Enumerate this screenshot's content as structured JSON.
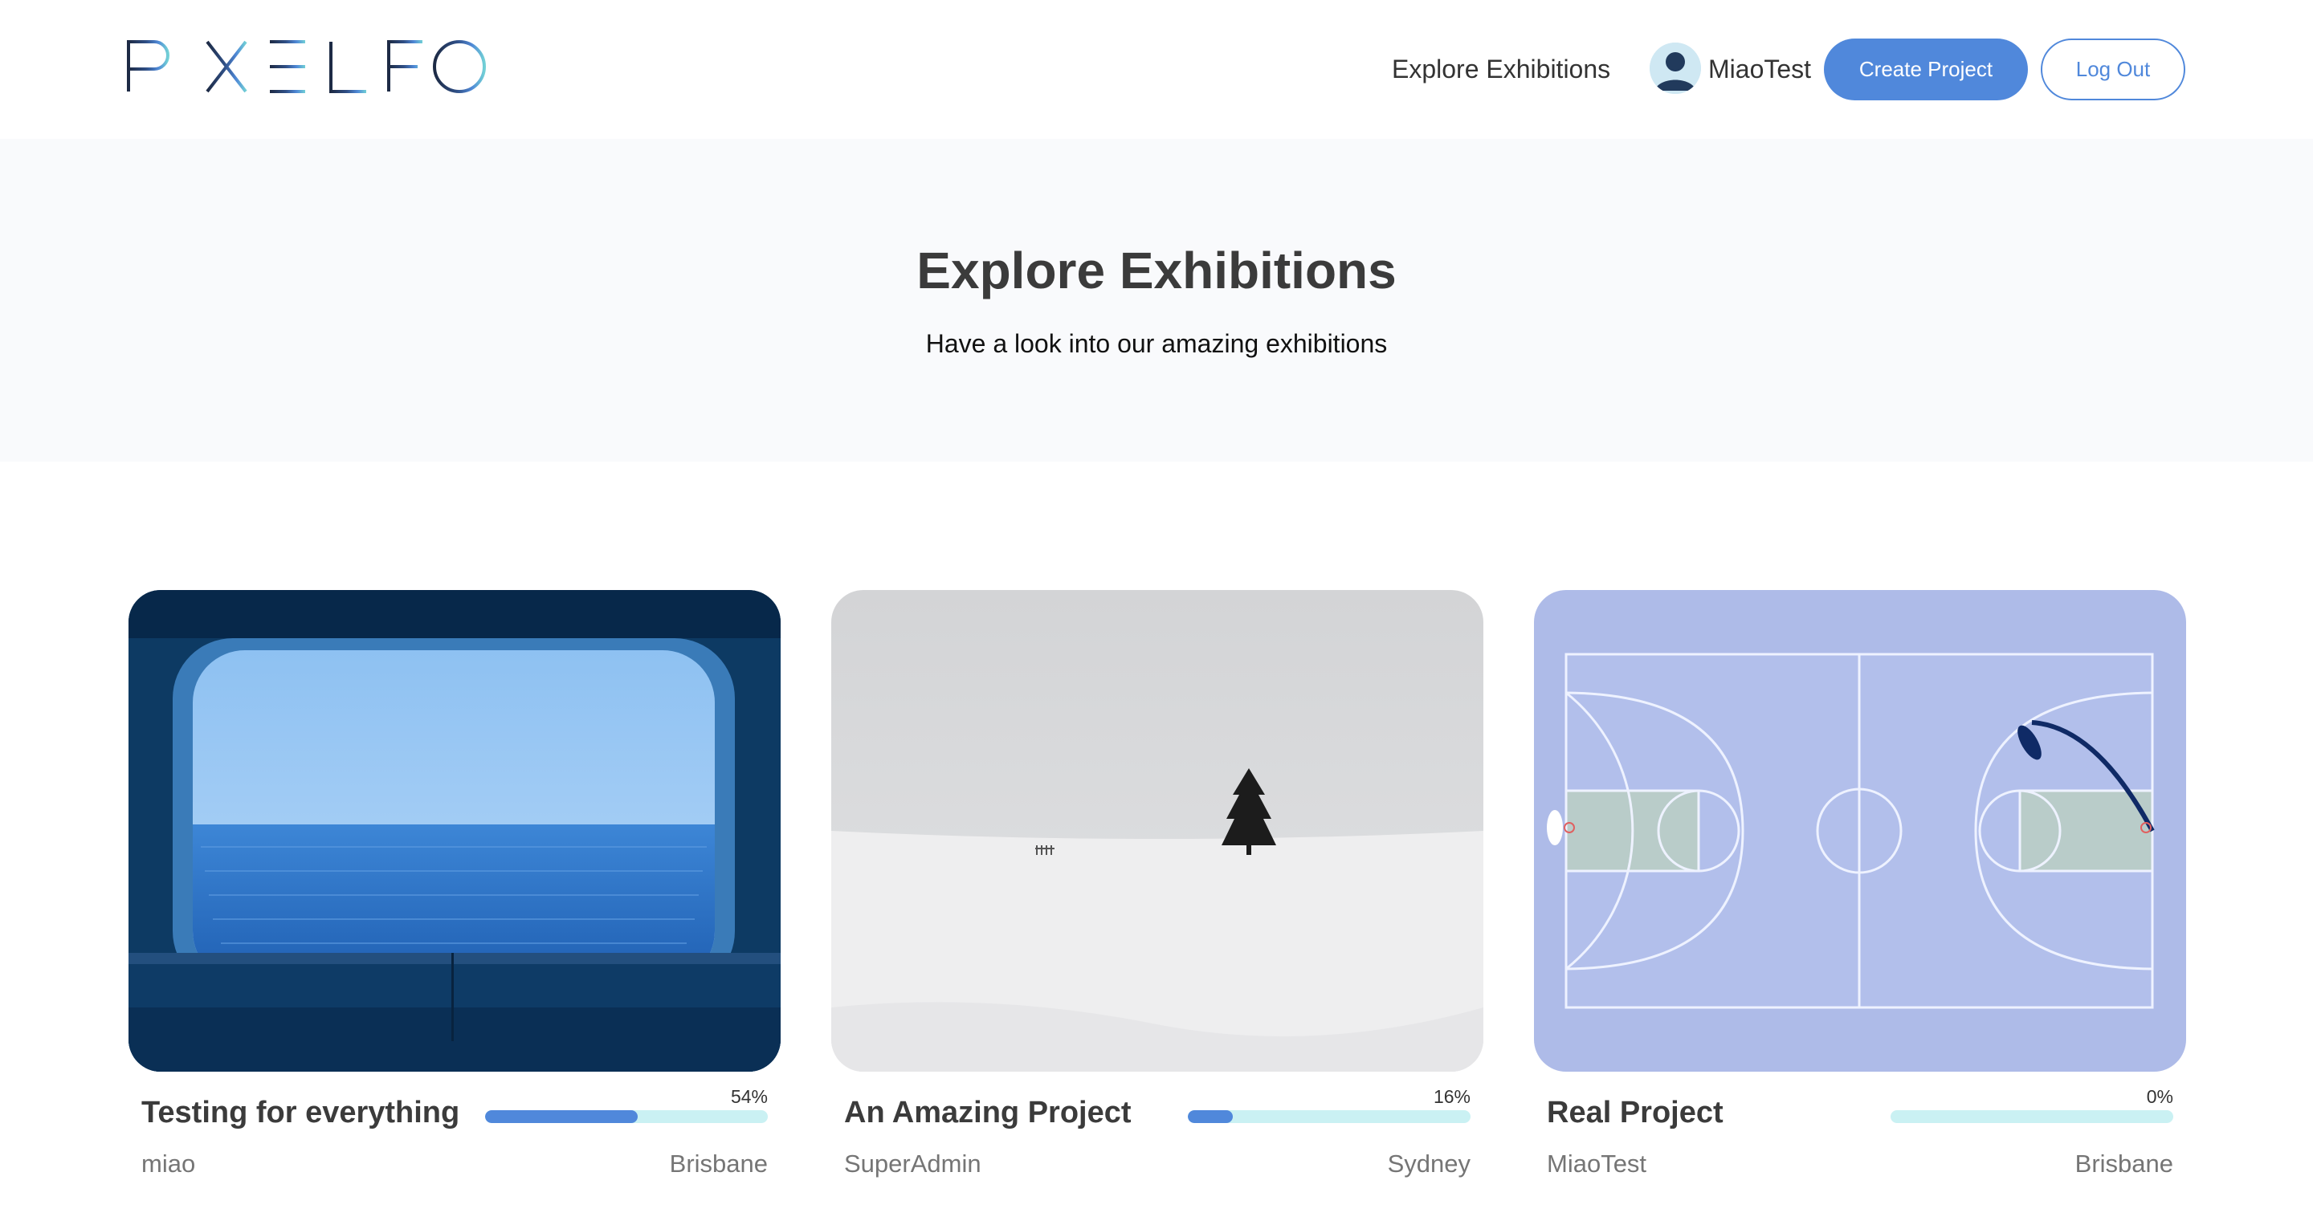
{
  "header": {
    "logo_text": "PIXELFOTO",
    "nav_explore": "Explore Exhibitions",
    "user_name": "MiaoTest",
    "create_label": "Create Project",
    "logout_label": "Log Out",
    "brand_color": "#5088db"
  },
  "hero": {
    "title": "Explore Exhibitions",
    "subtitle": "Have a look into our amazing exhibitions"
  },
  "cards": [
    {
      "title": "Testing for everything",
      "progress_label": "54%",
      "progress": 0.54,
      "owner": "miao",
      "location": "Brisbane",
      "image": "ship-window-ocean"
    },
    {
      "title": "An Amazing Project",
      "progress_label": "16%",
      "progress": 0.16,
      "owner": "SuperAdmin",
      "location": "Sydney",
      "image": "snow-tree"
    },
    {
      "title": "Real Project",
      "progress_label": "0%",
      "progress": 0.0,
      "owner": "MiaoTest",
      "location": "Brisbane",
      "image": "basketball-court"
    }
  ]
}
